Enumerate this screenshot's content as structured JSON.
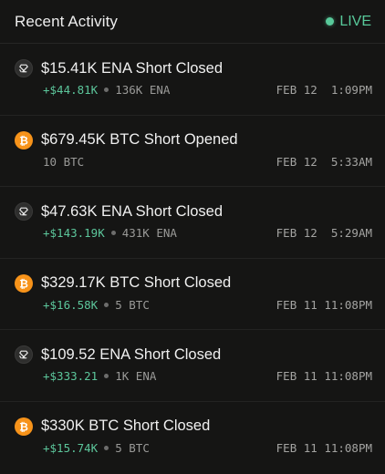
{
  "header": {
    "title": "Recent Activity",
    "live_label": "LIVE"
  },
  "colors": {
    "live": "#58c99a",
    "pnl_positive": "#5cc69b",
    "btc": "#f7931a"
  },
  "activities": [
    {
      "icon": "ena-icon",
      "title": "$15.41K ENA Short Closed",
      "pnl": "+$44.81K",
      "size": "136K ENA",
      "time": "FEB 12  1:09PM"
    },
    {
      "icon": "btc-icon",
      "title": "$679.45K BTC Short Opened",
      "pnl": "",
      "size": "10 BTC",
      "time": "FEB 12  5:33AM"
    },
    {
      "icon": "ena-icon",
      "title": "$47.63K ENA Short Closed",
      "pnl": "+$143.19K",
      "size": "431K ENA",
      "time": "FEB 12  5:29AM"
    },
    {
      "icon": "btc-icon",
      "title": "$329.17K BTC Short Closed",
      "pnl": "+$16.58K",
      "size": "5 BTC",
      "time": "FEB 11 11:08PM"
    },
    {
      "icon": "ena-icon",
      "title": "$109.52 ENA Short Closed",
      "pnl": "+$333.21",
      "size": "1K ENA",
      "time": "FEB 11 11:08PM"
    },
    {
      "icon": "btc-icon",
      "title": "$330K BTC Short Closed",
      "pnl": "+$15.74K",
      "size": "5 BTC",
      "time": "FEB 11 11:08PM"
    }
  ]
}
